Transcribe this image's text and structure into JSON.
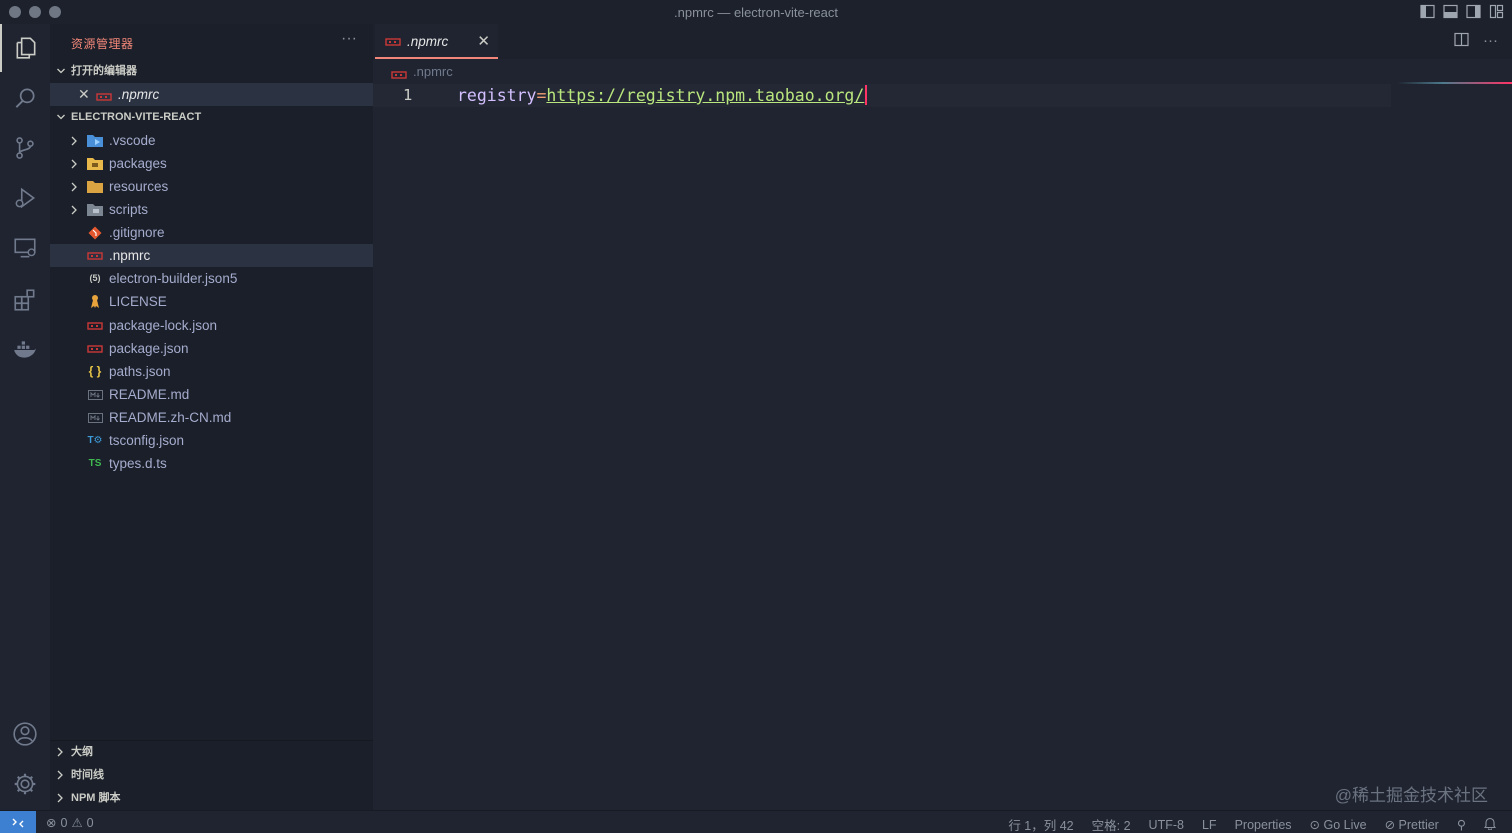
{
  "window": {
    "title": ".npmrc — electron-vite-react"
  },
  "sidebar": {
    "title": "资源管理器",
    "more": "···",
    "open_editors_label": "打开的编辑器",
    "open_editor_file": ".npmrc",
    "project_label": "ELECTRON-VITE-REACT",
    "tree": [
      {
        "name": ".vscode",
        "type": "folder"
      },
      {
        "name": "packages",
        "type": "folder"
      },
      {
        "name": "resources",
        "type": "folder"
      },
      {
        "name": "scripts",
        "type": "folder"
      },
      {
        "name": ".gitignore",
        "type": "file"
      },
      {
        "name": ".npmrc",
        "type": "file"
      },
      {
        "name": "electron-builder.json5",
        "type": "file"
      },
      {
        "name": "LICENSE",
        "type": "file"
      },
      {
        "name": "package-lock.json",
        "type": "file"
      },
      {
        "name": "package.json",
        "type": "file"
      },
      {
        "name": "paths.json",
        "type": "file"
      },
      {
        "name": "README.md",
        "type": "file"
      },
      {
        "name": "README.zh-CN.md",
        "type": "file"
      },
      {
        "name": "tsconfig.json",
        "type": "file"
      },
      {
        "name": "types.d.ts",
        "type": "file"
      }
    ],
    "bottom_sections": [
      "大纲",
      "时间线",
      "NPM 脚本"
    ]
  },
  "editor": {
    "tab_label": ".npmrc",
    "breadcrumb": ".npmrc",
    "line_number": "1",
    "code_key": "registry",
    "code_eq": "=",
    "code_value": "https://registry.npm.taobao.org/"
  },
  "statusbar": {
    "errors": "0",
    "warnings": "0",
    "position": "行 1，列 42",
    "spaces": "空格: 2",
    "encoding": "UTF-8",
    "eol": "LF",
    "language": "Properties",
    "golive": "Go Live",
    "prettier": "Prettier"
  },
  "watermark": "@稀土掘金技术社区",
  "colors": {
    "accent": "#f28779",
    "remote": "#3d7fd1",
    "cursor": "#ff3366"
  }
}
